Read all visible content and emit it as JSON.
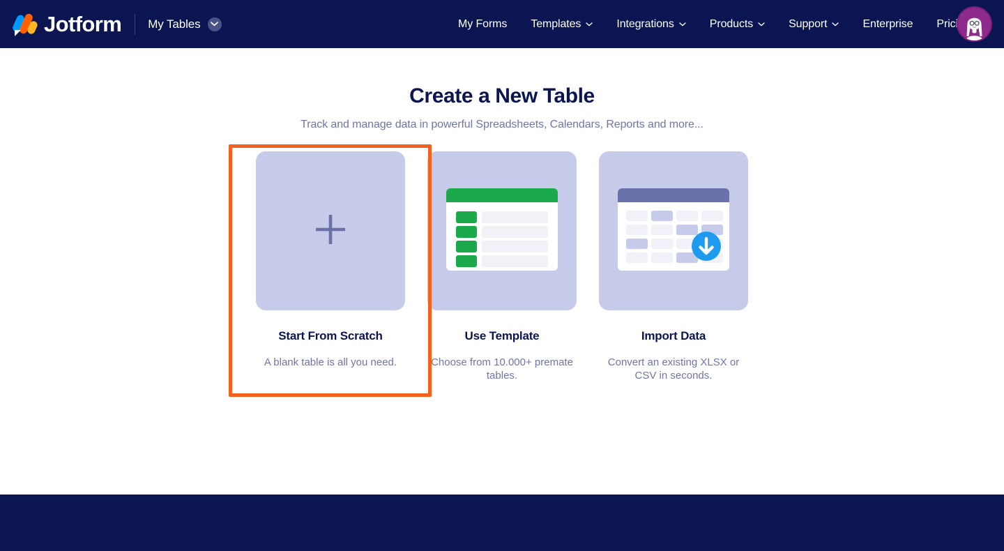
{
  "header": {
    "logo_text": "Jotform",
    "logo_icon": "jotform-logo-icon",
    "workspace_label": "My Tables",
    "workspace_chevron_icon": "chevron-down-icon",
    "nav_items": [
      {
        "label": "My Forms",
        "has_caret": false
      },
      {
        "label": "Templates",
        "has_caret": true
      },
      {
        "label": "Integrations",
        "has_caret": true
      },
      {
        "label": "Products",
        "has_caret": true
      },
      {
        "label": "Support",
        "has_caret": true
      },
      {
        "label": "Enterprise",
        "has_caret": false
      },
      {
        "label": "Pricing",
        "has_caret": false
      }
    ],
    "avatar_icon": "user-avatar",
    "background_color": "#0a1551"
  },
  "close_button": {
    "icon": "close-icon",
    "background_color": "#e3e5f3"
  },
  "main": {
    "title": "Create a New Table",
    "subtitle": "Track and manage data in powerful Spreadsheets, Calendars, Reports and more...",
    "cards": [
      {
        "title": "Start From Scratch",
        "description": "A blank table is all you need.",
        "art_icon": "plus-icon",
        "highlighted": true
      },
      {
        "title": "Use Template",
        "description": "Choose from 10.000+ premate tables.",
        "art_icon": "template-table-icon",
        "highlighted": false
      },
      {
        "title": "Import Data",
        "description": "Convert an existing XLSX or CSV in seconds.",
        "art_icon": "import-table-icon",
        "highlighted": false
      }
    ]
  },
  "colors": {
    "brand_navy": "#0a1551",
    "highlight_orange": "#f4601d",
    "art_lavender": "#c5cbe9",
    "template_green": "#1ba94c",
    "import_blue": "#1e9bf0",
    "muted_text": "#6f76a7"
  }
}
